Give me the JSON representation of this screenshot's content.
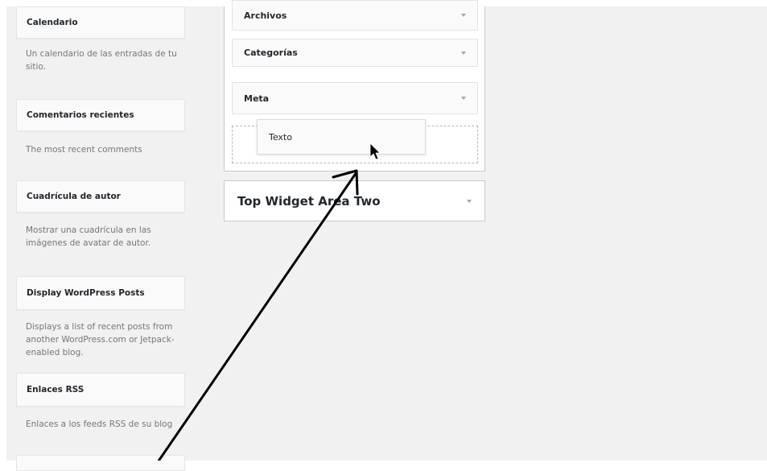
{
  "available_widgets": [
    {
      "title": "Calendario",
      "description": "Un calendario de las entradas de tu sitio."
    },
    {
      "title": "Comentarios recientes",
      "description": "The most recent comments"
    },
    {
      "title": "Cuadrícula de autor",
      "description": "Mostrar una cuadrícula en las imágenes de avatar de autor."
    },
    {
      "title": "Display WordPress Posts",
      "description": "Displays a list of recent posts from another WordPress.com or Jetpack-enabled blog."
    },
    {
      "title": "Enlaces RSS",
      "description": "Enlaces a los feeds RSS de su blog"
    }
  ],
  "sidebar_area": {
    "widgets": [
      {
        "label": "Archivos"
      },
      {
        "label": "Categorías"
      },
      {
        "label": "Meta"
      }
    ],
    "dragging_widget": "Texto"
  },
  "widget_area_two": {
    "title": "Top Widget Area Two"
  },
  "icons": {
    "widget_toggle": "caret-down-icon",
    "cursor": "mouse-pointer-icon",
    "annotation": "arrow-icon"
  },
  "colors": {
    "background": "#f1f1f1",
    "card": "#fafafa",
    "border": "#dddddd",
    "annotation_arrow": "#000000"
  }
}
